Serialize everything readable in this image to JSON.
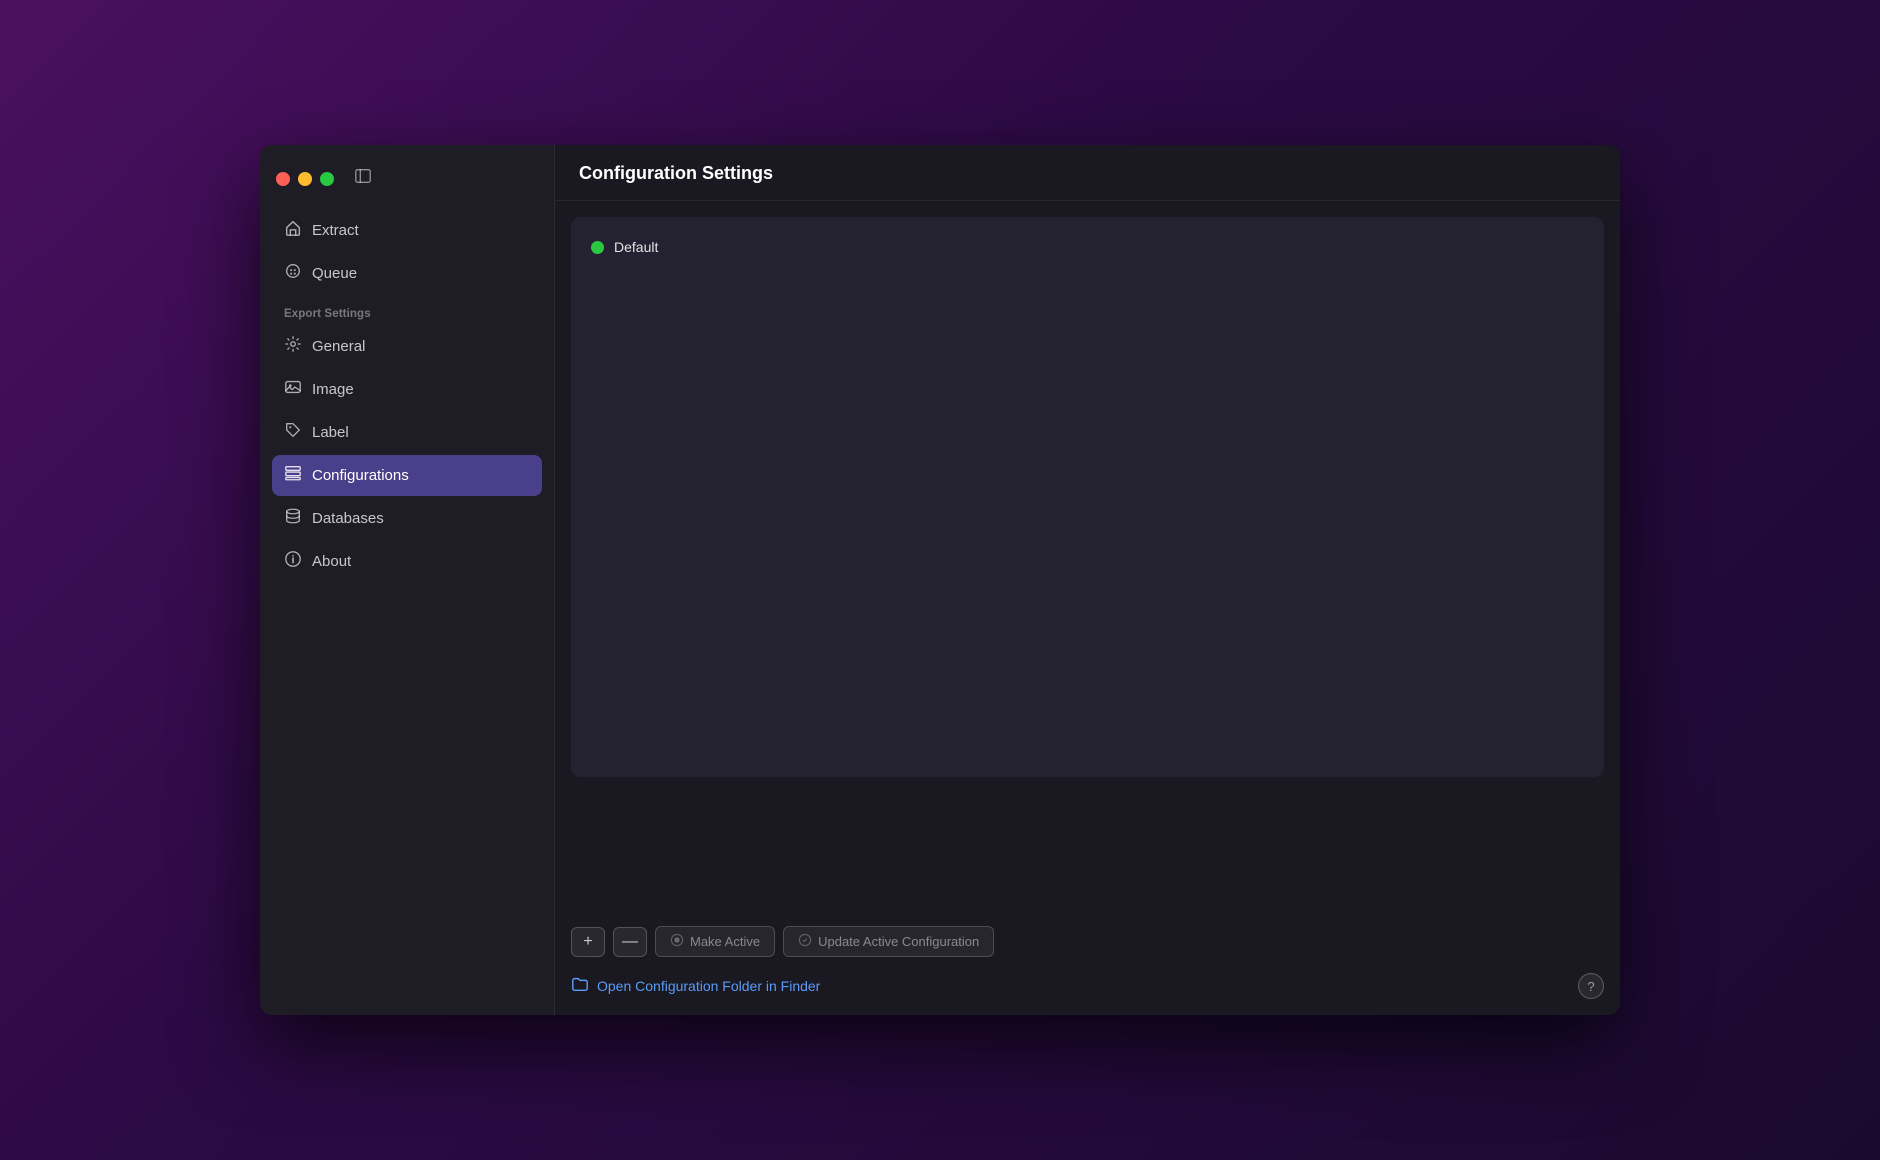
{
  "window": {
    "title": "Configuration Settings"
  },
  "sidebar": {
    "nav_items": [
      {
        "id": "extract",
        "label": "Extract",
        "icon": "house"
      },
      {
        "id": "queue",
        "label": "Queue",
        "icon": "queue"
      }
    ],
    "section_label": "Export Settings",
    "export_items": [
      {
        "id": "general",
        "label": "General",
        "icon": "gear"
      },
      {
        "id": "image",
        "label": "Image",
        "icon": "image"
      },
      {
        "id": "label",
        "label": "Label",
        "icon": "tag"
      },
      {
        "id": "configurations",
        "label": "Configurations",
        "icon": "configurations",
        "active": true
      },
      {
        "id": "databases",
        "label": "Databases",
        "icon": "database"
      },
      {
        "id": "about",
        "label": "About",
        "icon": "info"
      }
    ]
  },
  "main": {
    "header": "Configuration Settings",
    "config_items": [
      {
        "id": "default",
        "name": "Default",
        "active": true
      }
    ]
  },
  "toolbar": {
    "add_label": "+",
    "remove_label": "—",
    "make_active_label": "Make Active",
    "update_active_label": "Update Active Configuration"
  },
  "footer": {
    "open_folder_label": "Open Configuration Folder in Finder",
    "help_label": "?"
  },
  "colors": {
    "active_dot": "#2ac840",
    "sidebar_active_bg": "#4a3f8a",
    "link_blue": "#5b9cf6"
  }
}
